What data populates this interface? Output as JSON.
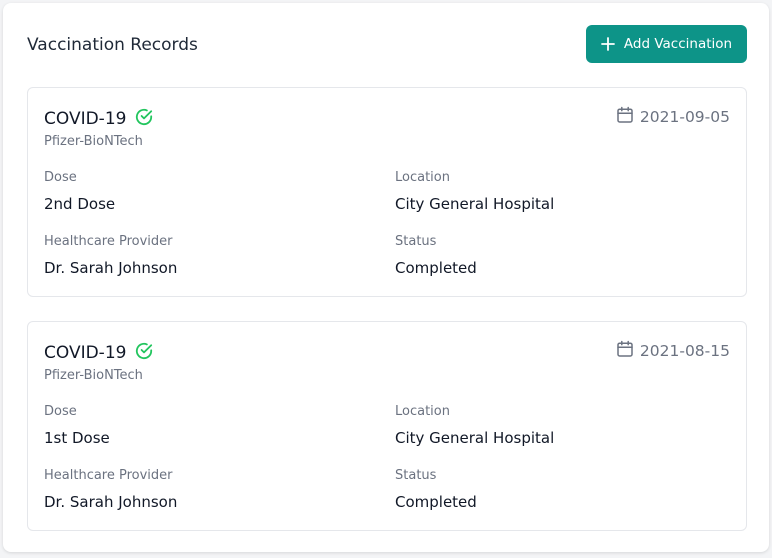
{
  "header": {
    "title": "Vaccination Records",
    "add_button_label": "Add Vaccination"
  },
  "colors": {
    "accent": "#0d9488",
    "verified": "#22c55e"
  },
  "records": [
    {
      "vaccine": "COVID-19",
      "manufacturer": "Pfizer-BioNTech",
      "date": "2021-09-05",
      "dose_label": "Dose",
      "dose": "2nd Dose",
      "location_label": "Location",
      "location": "City General Hospital",
      "provider_label": "Healthcare Provider",
      "provider": "Dr. Sarah Johnson",
      "status_label": "Status",
      "status": "Completed",
      "icons": [
        "check-circle-icon",
        "calendar-icon"
      ]
    },
    {
      "vaccine": "COVID-19",
      "manufacturer": "Pfizer-BioNTech",
      "date": "2021-08-15",
      "dose_label": "Dose",
      "dose": "1st Dose",
      "location_label": "Location",
      "location": "City General Hospital",
      "provider_label": "Healthcare Provider",
      "provider": "Dr. Sarah Johnson",
      "status_label": "Status",
      "status": "Completed",
      "icons": [
        "check-circle-icon",
        "calendar-icon"
      ]
    }
  ]
}
